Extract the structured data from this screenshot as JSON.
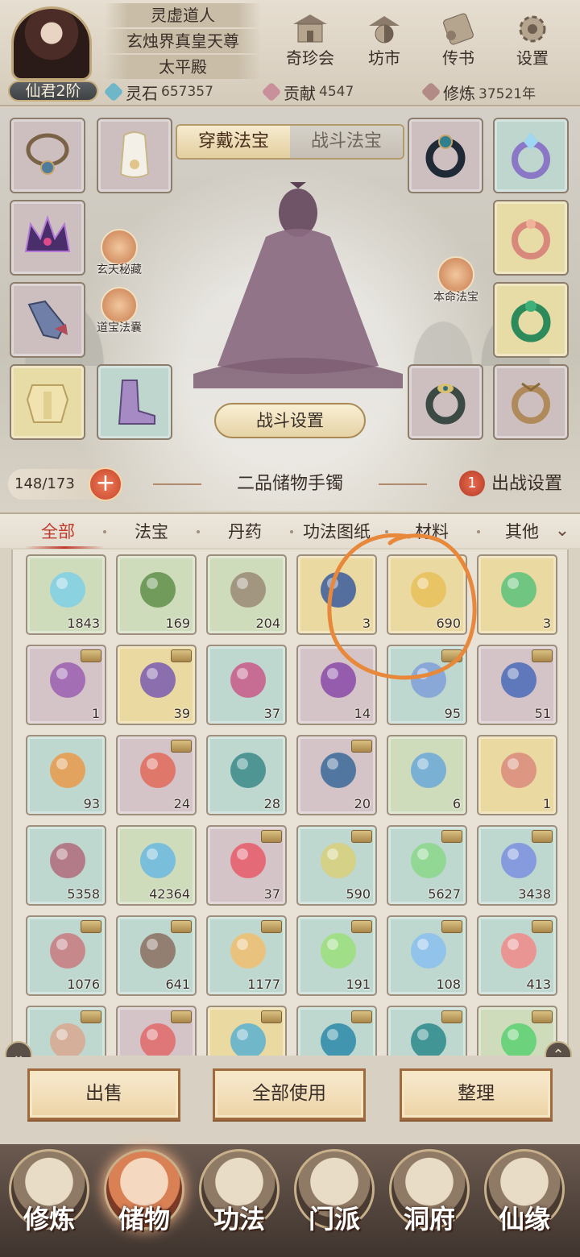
{
  "player": {
    "name": "灵虚道人",
    "title": "玄烛界真皇天尊",
    "location": "太平殿",
    "rank": "仙君2阶"
  },
  "top_menu": [
    {
      "label": "奇珍会",
      "icon": "treasure-pavilion-icon"
    },
    {
      "label": "坊市",
      "icon": "market-icon"
    },
    {
      "label": "传书",
      "icon": "scroll-mail-icon"
    },
    {
      "label": "设置",
      "icon": "gear-icon"
    }
  ],
  "stats": [
    {
      "name": "灵石",
      "value": "657357",
      "color": "#6fb7c8"
    },
    {
      "name": "贡献",
      "value": "4547",
      "color": "#c98f9a"
    },
    {
      "name": "修炼",
      "value": "37521年",
      "color": "#b28a86"
    }
  ],
  "equip": {
    "tab_active": "穿戴法宝",
    "tab_inactive": "战斗法宝",
    "side_left_1": "玄天秘藏",
    "side_left_2": "道宝法囊",
    "side_right": "本命法宝",
    "battle_settings": "战斗设置"
  },
  "bag": {
    "count": "148/173",
    "name": "二品储物手镯",
    "deploy_num": "1",
    "deploy_label": "出战设置"
  },
  "categories": [
    "全部",
    "法宝",
    "丹药",
    "功法图纸",
    "材料",
    "其他"
  ],
  "inventory": [
    {
      "count": "1843"
    },
    {
      "count": "169"
    },
    {
      "count": "204"
    },
    {
      "count": "3"
    },
    {
      "count": "690"
    },
    {
      "count": "3"
    },
    {
      "count": "1"
    },
    {
      "count": "39"
    },
    {
      "count": "37"
    },
    {
      "count": "14"
    },
    {
      "count": "95"
    },
    {
      "count": "51"
    },
    {
      "count": "93"
    },
    {
      "count": "24"
    },
    {
      "count": "28"
    },
    {
      "count": "20"
    },
    {
      "count": "6"
    },
    {
      "count": "1"
    },
    {
      "count": "5358"
    },
    {
      "count": "42364"
    },
    {
      "count": "37"
    },
    {
      "count": "590"
    },
    {
      "count": "5627"
    },
    {
      "count": "3438"
    },
    {
      "count": "1076"
    },
    {
      "count": "641"
    },
    {
      "count": "1177"
    },
    {
      "count": "191"
    },
    {
      "count": "108"
    },
    {
      "count": "413"
    },
    {
      "count": ""
    },
    {
      "count": ""
    },
    {
      "count": ""
    },
    {
      "count": ""
    },
    {
      "count": ""
    },
    {
      "count": ""
    }
  ],
  "actions": {
    "sell": "出售",
    "use_all": "全部使用",
    "sort": "整理"
  },
  "bottom_nav": [
    {
      "label": "修炼",
      "active": false
    },
    {
      "label": "储物",
      "active": true
    },
    {
      "label": "功法",
      "active": false
    },
    {
      "label": "门派",
      "active": false
    },
    {
      "label": "洞府",
      "active": false
    },
    {
      "label": "仙缘",
      "active": false
    }
  ],
  "colors": {
    "accent_red": "#c0392b",
    "annotation_orange": "#e8883a"
  }
}
